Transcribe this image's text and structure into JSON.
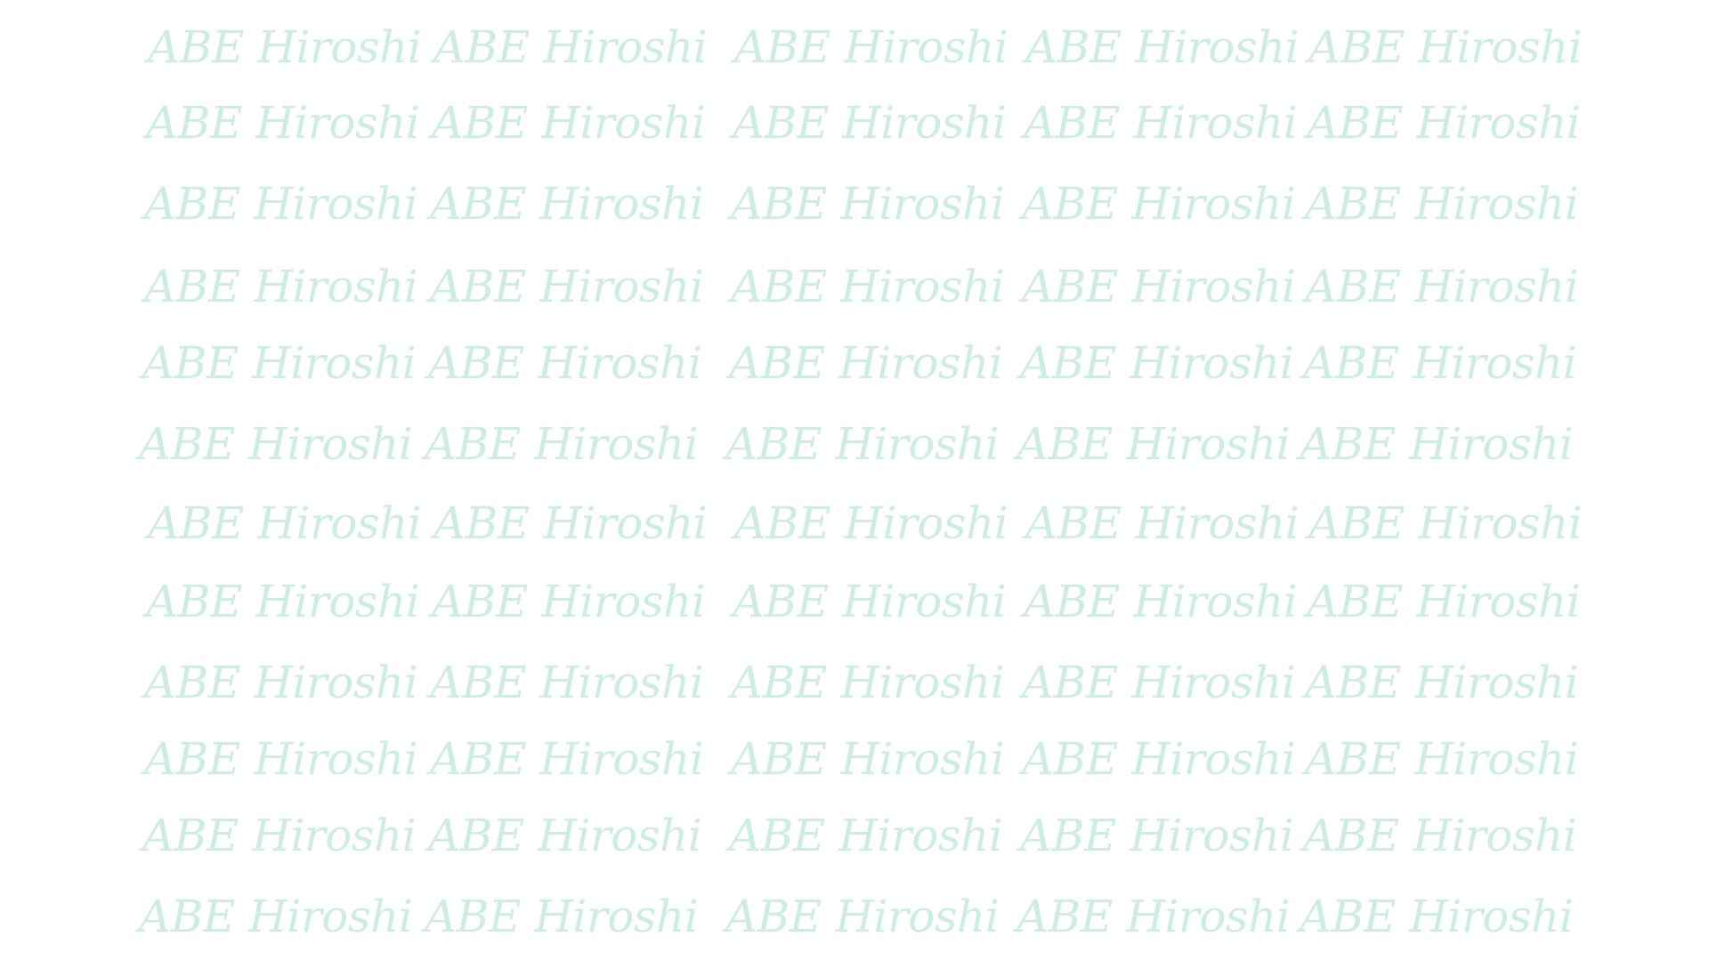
{
  "watermark": {
    "text": "ABE Hiroshi",
    "color": "#cdeedf",
    "rows": 12,
    "columns": 5
  }
}
